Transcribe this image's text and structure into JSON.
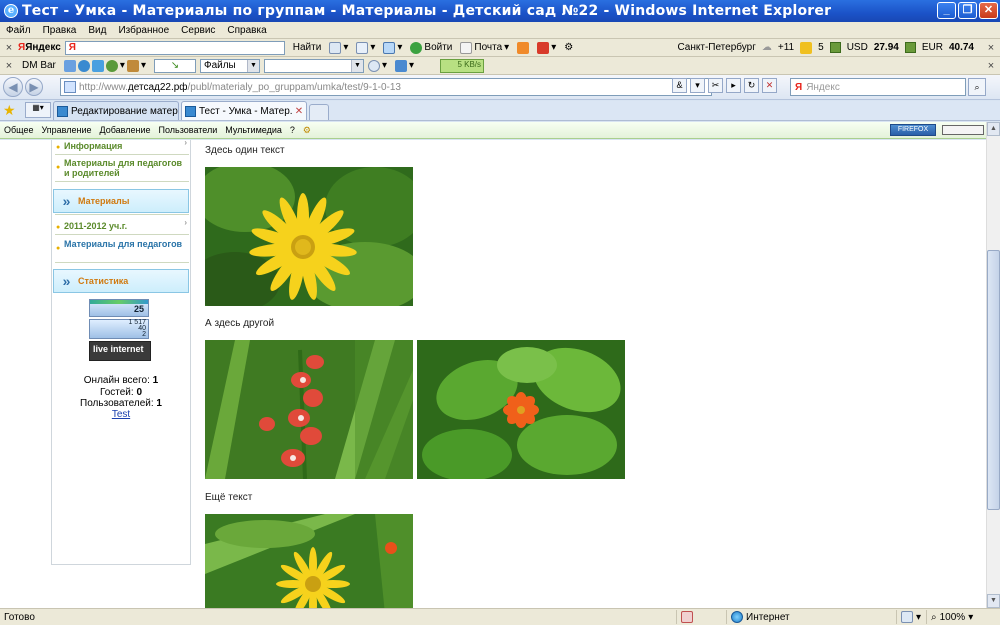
{
  "window": {
    "title": "Тест - Умка - Материалы по группам - Материалы - Детский сад №22 - Windows Internet Explorer",
    "minimize": "_",
    "maximize": "❐",
    "close": "✕"
  },
  "menu": [
    "Файл",
    "Правка",
    "Вид",
    "Избранное",
    "Сервис",
    "Справка"
  ],
  "yandex_bar": {
    "logo": "Яндекс",
    "input_value": "Я",
    "find_label": "Найти",
    "login_label": "Войти",
    "mail_label": "Почта",
    "city": "Санкт-Петербург",
    "temp": "+11",
    "traffic": "5",
    "usd_label": "USD",
    "usd_value": "27.94",
    "eur_label": "EUR",
    "eur_value": "40.74"
  },
  "dm_bar": {
    "label": "DM Bar",
    "files_label": "Файлы",
    "speed": "5 KB/s"
  },
  "address": {
    "prefix": "http://www.",
    "host": "детсад22.рф",
    "path": "/publ/materialy_po_gruppam/umka/test/9-1-0-13",
    "search_placeholder": "Яндекс"
  },
  "tabs": [
    {
      "label": "Редактирование матер..."
    },
    {
      "label": "Тест - Умка - Матер..."
    }
  ],
  "ucoz_panel": {
    "items": [
      "Общее",
      "Управление",
      "Добавление",
      "Пользователи",
      "Мультимедиа",
      "?"
    ],
    "firefox_label": "FIREFOX"
  },
  "sidebar": {
    "top_items": [
      {
        "label": "Информация"
      },
      {
        "label": "Материалы для педагогов и родителей"
      }
    ],
    "materials_title": "Материалы",
    "materials_items": [
      {
        "label": "2011-2012 уч.г."
      },
      {
        "label": "Материалы для педагогов"
      }
    ],
    "stats_title": "Статистика",
    "counter": {
      "top": "25",
      "row1": "1 517",
      "row2": "40",
      "row3": "2"
    },
    "liveinternet": "live internet",
    "online_total_label": "Онлайн всего:",
    "online_total": "1",
    "guests_label": "Гостей:",
    "guests": "0",
    "users_label": "Пользователей:",
    "users": "1",
    "user_link": "Test"
  },
  "content": {
    "text1": "Здесь один текст",
    "text2": "А здесь другой",
    "text3": "Ещё текст"
  },
  "status": {
    "left": "Готово",
    "zone": "Интернет",
    "zoom": "100%"
  }
}
